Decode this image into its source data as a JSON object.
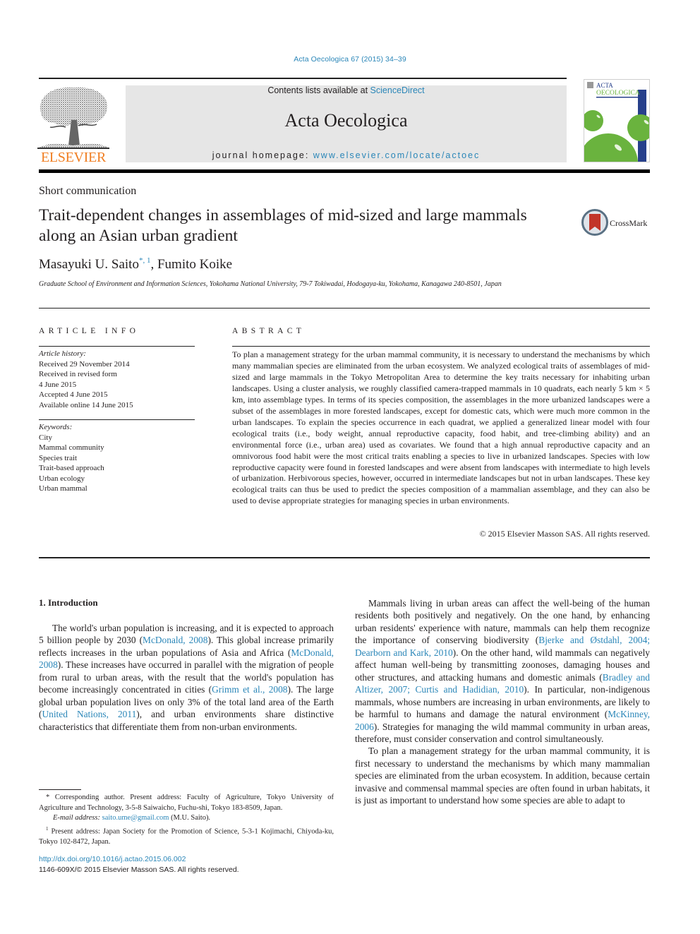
{
  "citation": "Acta Oecologica 67 (2015) 34–39",
  "header": {
    "contents_prefix": "Contents lists available at ",
    "contents_link": "ScienceDirect",
    "journal_title": "Acta Oecologica",
    "homepage_prefix": "journal homepage: ",
    "homepage_link": "www.elsevier.com/locate/actoec",
    "publisher_logo": "ELSEVIER",
    "cover_title_1": "ACTA",
    "cover_title_2": "OECOLOGICA",
    "colors": {
      "link": "#2a86b8",
      "elsevier_orange": "#f07e22",
      "cover_green": "#6ab33e",
      "cover_blue": "#27408b",
      "band_gray": "#e6e6e6"
    }
  },
  "article": {
    "type": "Short communication",
    "title": "Trait-dependent changes in assemblages of mid-sized and large mammals along an Asian urban gradient",
    "crossmark_label": "CrossMark",
    "authors": [
      {
        "name": "Masayuki U. Saito",
        "marks": "*, 1"
      },
      {
        "name": "Fumito Koike",
        "marks": ""
      }
    ],
    "author_separator": ", ",
    "affiliation": "Graduate School of Environment and Information Sciences, Yokohama National University, 79-7 Tokiwadai, Hodogaya-ku, Yokohama, Kanagawa 240-8501, Japan"
  },
  "article_info": {
    "heading": "ARTICLE INFO",
    "history_label": "Article history:",
    "history": [
      "Received 29 November 2014",
      "Received in revised form",
      "4 June 2015",
      "Accepted 4 June 2015",
      "Available online 14 June 2015"
    ],
    "keywords_label": "Keywords:",
    "keywords": [
      "City",
      "Mammal community",
      "Species trait",
      "Trait-based approach",
      "Urban ecology",
      "Urban mammal"
    ]
  },
  "abstract": {
    "heading": "ABSTRACT",
    "text": "To plan a management strategy for the urban mammal community, it is necessary to understand the mechanisms by which many mammalian species are eliminated from the urban ecosystem. We analyzed ecological traits of assemblages of mid-sized and large mammals in the Tokyo Metropolitan Area to determine the key traits necessary for inhabiting urban landscapes. Using a cluster analysis, we roughly classified camera-trapped mammals in 10 quadrats, each nearly 5 km × 5 km, into assemblage types. In terms of its species composition, the assemblages in the more urbanized landscapes were a subset of the assemblages in more forested landscapes, except for domestic cats, which were much more common in the urban landscapes. To explain the species occurrence in each quadrat, we applied a generalized linear model with four ecological traits (i.e., body weight, annual reproductive capacity, food habit, and tree-climbing ability) and an environmental force (i.e., urban area) used as covariates. We found that a high annual reproductive capacity and an omnivorous food habit were the most critical traits enabling a species to live in urbanized landscapes. Species with low reproductive capacity were found in forested landscapes and were absent from landscapes with intermediate to high levels of urbanization. Herbiv­orous species, however, occurred in intermediate landscapes but not in urban landscapes. These key ecological traits can thus be used to predict the species composition of a mammalian assemblage, and they can also be used to devise appropriate strategies for managing species in urban environments.",
    "copyright": "© 2015 Elsevier Masson SAS. All rights reserved."
  },
  "body": {
    "section_heading": "1.  Introduction",
    "left_paragraph": [
      {
        "t": "The world's urban population is increasing, and it is expected to approach 5 billion people by 2030 ("
      },
      {
        "link": "McDonald, 2008"
      },
      {
        "t": "). This global increase primarily reflects increases in the urban populations of Asia and Africa ("
      },
      {
        "link": "McDonald, 2008"
      },
      {
        "t": "). These increases have occurred in parallel with the migration of people from rural to urban areas, with the result that the world's population has become increasingly concentrated in cities ("
      },
      {
        "link": "Grimm et al., 2008"
      },
      {
        "t": "). The large global urban population lives on only 3% of the total land area of the Earth ("
      },
      {
        "link": "United Nations, 2011"
      },
      {
        "t": "), and urban environments share distinctive characteristics that differentiate them from non-urban environments."
      }
    ],
    "right_paragraph_1": [
      {
        "t": "Mammals living in urban areas can affect the well-being of the human residents both positively and negatively. On the one hand, by enhancing urban residents' experience with nature, mammals can help them recognize the importance of conserving biodiversity ("
      },
      {
        "link": "Bjerke and Østdahl, 2004; Dearborn and Kark, 2010"
      },
      {
        "t": "). On the other hand, wild mammals can negatively affect human well-being by transmitting zoonoses, damaging houses and other structures, and attacking humans and domestic animals ("
      },
      {
        "link": "Bradley and Altizer, 2007; Curtis and Hadidian, 2010"
      },
      {
        "t": "). In particular, non-indigenous mam­mals, whose numbers are increasing in urban environments, are likely to be harmful to humans and damage the natural environ­ment ("
      },
      {
        "link": "McKinney, 2006"
      },
      {
        "t": "). Strategies for managing the wild mammal community in urban areas, therefore, must consider conservation and control simultaneously."
      }
    ],
    "right_paragraph_2": [
      {
        "t": "To plan a management strategy for the urban mammal com­munity, it is first necessary to understand the mechanisms by which many mammalian species are eliminated from the urban ecosystem. In addition, because certain invasive and commensal mammal species are often found in urban habitats, it is just as important to understand how some species are able to adapt to"
      }
    ]
  },
  "footnotes": {
    "corresponding": "* Corresponding author. Present address: Faculty of Agriculture, Tokyo University of Agriculture and Technology, 3-5-8 Saiwaicho, Fuchu-shi, Tokyo 183-8509, Japan.",
    "email_label": "E-mail address: ",
    "email": "saito.ume@gmail.com",
    "email_suffix": " (M.U. Saito).",
    "note1_mark": "1",
    "note1": " Present address: Japan Society for the Promotion of Science, 5-3-1 Kojimachi, Chiyoda-ku, Tokyo 102-8472, Japan.",
    "doi": "http://dx.doi.org/10.1016/j.actao.2015.06.002",
    "issn": "1146-609X/© 2015 Elsevier Masson SAS. All rights reserved."
  }
}
